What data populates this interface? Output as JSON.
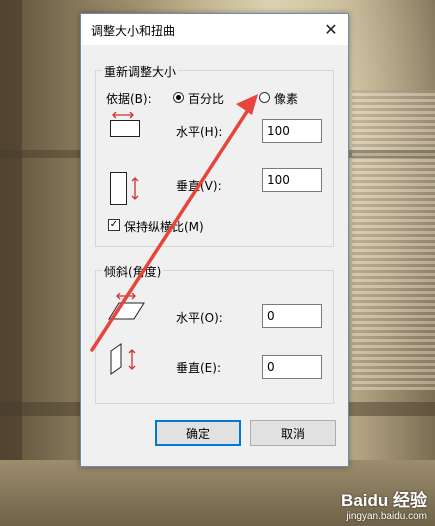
{
  "dialog": {
    "title": "调整大小和扭曲",
    "close_glyph": "✕"
  },
  "resize": {
    "legend": "重新调整大小",
    "basis_label": "依据(B):",
    "percent_label": "百分比",
    "pixels_label": "像素",
    "selected": "percent",
    "horizontal_label": "水平(H):",
    "horizontal_value": "100",
    "vertical_label": "垂直(V):",
    "vertical_value": "100",
    "keep_ratio_label": "保持纵横比(M)",
    "keep_ratio_checked": true
  },
  "skew": {
    "legend": "倾斜(角度)",
    "horizontal_label": "水平(O):",
    "horizontal_value": "0",
    "vertical_label": "垂直(E):",
    "vertical_value": "0"
  },
  "buttons": {
    "ok": "确定",
    "cancel": "取消"
  },
  "watermark": {
    "logo": "Baidu 经验",
    "url": "jingyan.baidu.com"
  },
  "colors": {
    "arrow": "#e8433c",
    "icon_red": "#d03030"
  }
}
